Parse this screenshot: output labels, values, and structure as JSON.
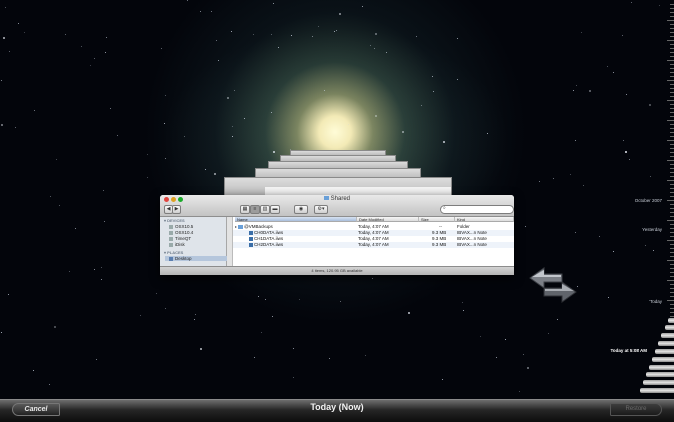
{
  "finder": {
    "title": "Shared",
    "view_buttons": [
      "icon-view",
      "list-view",
      "column-view",
      "cover-flow"
    ],
    "sidebar": {
      "devices_header": "DEVICES",
      "devices": [
        "OSX10.5",
        "OSX10.4",
        "TimeQT",
        "iDisk"
      ],
      "places_header": "PLACES",
      "places": [
        "Desktop"
      ]
    },
    "columns": [
      "Name",
      "Date Modified",
      "Size",
      "Kind"
    ],
    "rows": [
      {
        "name": "@VMBackups",
        "date": "Today, 4:07 AM",
        "size": "--",
        "kind": "Folder"
      },
      {
        "name": "CH0DATA.iiws",
        "date": "Today, 4:07 AM",
        "size": "9.3 MB",
        "kind": "IBVAX...n Note"
      },
      {
        "name": "CH1DATA.iiws",
        "date": "Today, 4:07 AM",
        "size": "9.3 MB",
        "kind": "IBVAX...n Note"
      },
      {
        "name": "CH2DATA.iiws",
        "date": "Today, 4:07 AM",
        "size": "9.3 MB",
        "kind": "IBVAX...n Note"
      }
    ],
    "status": "4 items, 120.95 GB available"
  },
  "timeline": {
    "labels": [
      {
        "text": "October 2007"
      },
      {
        "text": "Yesterday"
      },
      {
        "text": "Today"
      },
      {
        "text": "Today at 5:08 AM",
        "current": true
      }
    ]
  },
  "bottombar": {
    "cancel_label": "Cancel",
    "title": "Today (Now)",
    "restore_label": "Restore"
  },
  "colors": {
    "window_chrome": "#c3c3c3",
    "selected_row": "#b5c6dc",
    "close_button": "#e0443e",
    "minimize_button": "#dea123",
    "zoom_button": "#1aab29"
  }
}
